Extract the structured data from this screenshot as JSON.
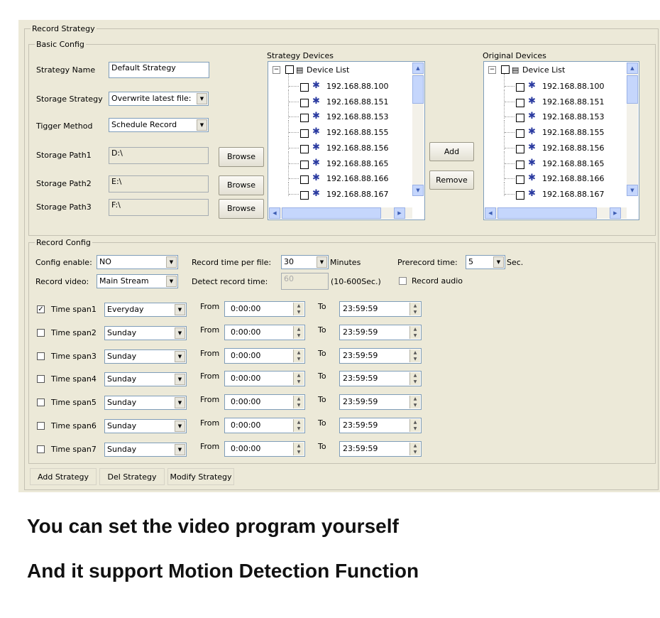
{
  "record_strategy": {
    "title": "Record Strategy",
    "basic_config": {
      "title": "Basic Config",
      "strategy_name_label": "Strategy Name",
      "strategy_name_value": "Default Strategy",
      "storage_strategy_label": "Storage Strategy",
      "storage_strategy_value": "Overwrite latest file:",
      "trigger_method_label": "Tigger Method",
      "trigger_method_value": "Schedule Record",
      "paths": [
        {
          "label": "Storage Path1",
          "value": "D:\\",
          "browse": "Browse"
        },
        {
          "label": "Storage Path2",
          "value": "E:\\",
          "browse": "Browse"
        },
        {
          "label": "Storage Path3",
          "value": "F:\\",
          "browse": "Browse"
        }
      ],
      "strategy_devices": {
        "title": "Strategy Devices",
        "root": "Device List",
        "items": [
          "192.168.88.100",
          "192.168.88.151",
          "192.168.88.153",
          "192.168.88.155",
          "192.168.88.156",
          "192.168.88.165",
          "192.168.88.166",
          "192.168.88.167"
        ]
      },
      "original_devices": {
        "title": "Original Devices",
        "root": "Device List",
        "items": [
          "192.168.88.100",
          "192.168.88.151",
          "192.168.88.153",
          "192.168.88.155",
          "192.168.88.156",
          "192.168.88.165",
          "192.168.88.166",
          "192.168.88.167"
        ]
      },
      "add_label": "Add",
      "remove_label": "Remove"
    },
    "record_config": {
      "title": "Record Config",
      "config_enable_label": "Config enable:",
      "config_enable_value": "NO",
      "record_video_label": "Record video:",
      "record_video_value": "Main Stream",
      "record_time_label": "Record time per file:",
      "record_time_value": "30",
      "record_time_unit": "Minutes",
      "detect_time_label": "Detect record time:",
      "detect_time_value": "60",
      "detect_time_range": "(10-600Sec.)",
      "prerecord_label": "Prerecord time:",
      "prerecord_value": "5",
      "prerecord_unit": "Sec.",
      "record_audio_label": "Record audio",
      "from_label": "From",
      "to_label": "To",
      "time_spans": [
        {
          "label": "Time span1",
          "checked": true,
          "day": "Everyday",
          "from": "0:00:00",
          "to": "23:59:59"
        },
        {
          "label": "Time span2",
          "checked": false,
          "day": "Sunday",
          "from": "0:00:00",
          "to": "23:59:59"
        },
        {
          "label": "Time span3",
          "checked": false,
          "day": "Sunday",
          "from": "0:00:00",
          "to": "23:59:59"
        },
        {
          "label": "Time span4",
          "checked": false,
          "day": "Sunday",
          "from": "0:00:00",
          "to": "23:59:59"
        },
        {
          "label": "Time span5",
          "checked": false,
          "day": "Sunday",
          "from": "0:00:00",
          "to": "23:59:59"
        },
        {
          "label": "Time span6",
          "checked": false,
          "day": "Sunday",
          "from": "0:00:00",
          "to": "23:59:59"
        },
        {
          "label": "Time span7",
          "checked": false,
          "day": "Sunday",
          "from": "0:00:00",
          "to": "23:59:59"
        }
      ]
    },
    "actions": {
      "add_strategy": "Add Strategy",
      "del_strategy": "Del Strategy",
      "modify_strategy": "Modify Strategy"
    }
  },
  "captions": {
    "line1": "You can set the video program yourself",
    "line2": "And it support Motion Detection Function"
  }
}
